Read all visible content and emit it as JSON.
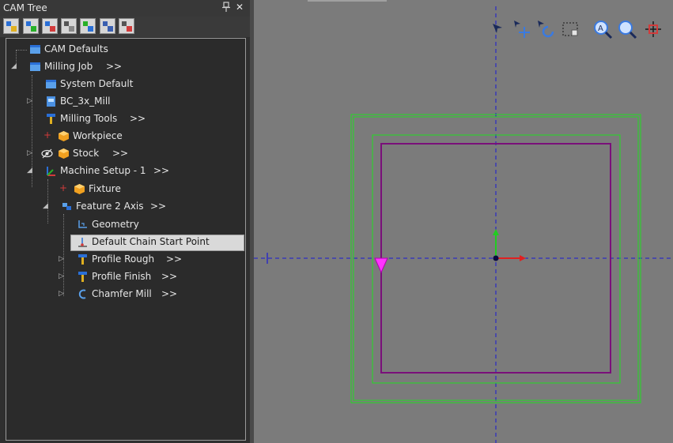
{
  "panel": {
    "title": "CAM Tree",
    "pin_icon": "pin-icon",
    "close_icon": "close-icon",
    "close_glyph": "✕",
    "toolbar_icons": [
      "select-operations-icon",
      "expand-tree-icon",
      "filter-icon",
      "toggle-display-icon",
      "regenerate-icon",
      "layout-icon",
      "properties-icon"
    ]
  },
  "tree": {
    "items": [
      {
        "label": "CAM Defaults",
        "icon": "cam-defaults-icon",
        "more": ""
      },
      {
        "label": "Milling Job",
        "icon": "milling-job-icon",
        "more": ">>"
      },
      {
        "label": "System Default",
        "icon": "system-default-icon",
        "more": ""
      },
      {
        "label": "BC_3x_Mill",
        "icon": "machine-icon",
        "more": ""
      },
      {
        "label": "Milling Tools",
        "icon": "tool-icon",
        "more": ">>"
      },
      {
        "label": "Workpiece",
        "icon": "workpiece-box-icon",
        "more": ""
      },
      {
        "label": "Stock",
        "icon": "stock-box-icon",
        "more": ">>"
      },
      {
        "label": "Machine Setup - 1",
        "icon": "machine-setup-icon",
        "more": ">>"
      },
      {
        "label": "Fixture",
        "icon": "fixture-box-icon",
        "more": ""
      },
      {
        "label": "Feature 2 Axis",
        "icon": "feature-icon",
        "more": ">>"
      },
      {
        "label": "Geometry",
        "icon": "geometry-icon",
        "more": ""
      },
      {
        "label": "Default Chain Start Point",
        "icon": "chain-start-point-icon",
        "more": ""
      },
      {
        "label": "Profile Rough",
        "icon": "profile-tool-icon",
        "more": ">>"
      },
      {
        "label": "Profile Finish",
        "icon": "profile-tool-icon",
        "more": ">>"
      },
      {
        "label": "Chamfer Mill",
        "icon": "chamfer-icon",
        "more": ">>"
      }
    ],
    "selected": "Default Chain Start Point"
  },
  "viewport": {
    "toolbar_icons": [
      "pan-cursor-icon",
      "move-icon",
      "rotate-icon",
      "box-select-icon",
      "zoom-fit-icon",
      "zoom-icon",
      "crosshair-icon"
    ]
  },
  "colors": {
    "accent_green": "#22dd22",
    "profile_purple": "#7a0f7a",
    "axis_blue": "#1a1ad6",
    "start_marker": "#ff33ff"
  }
}
